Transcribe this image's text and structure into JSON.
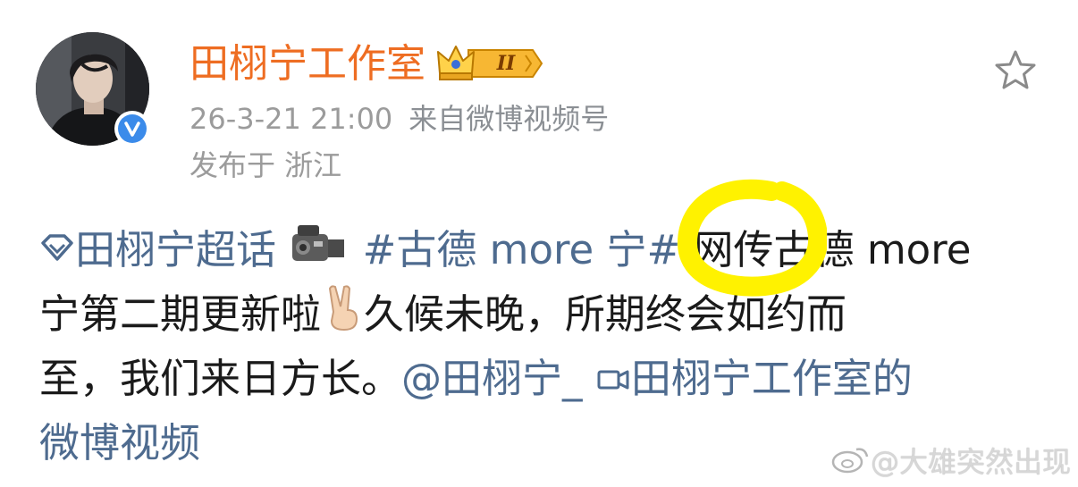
{
  "account": {
    "username": "田栩宁工作室",
    "badge_level": "II",
    "timestamp": "26-3-21 21:00",
    "source": "来自微博视频号",
    "location": "发布于 浙江"
  },
  "post": {
    "supertopic": "田栩宁超话",
    "hashtag": "#古德 more 宁#",
    "text_part1": "网传古德 more",
    "text_part2": "宁第二期更新啦",
    "text_part3": "久候未晚，所期终会如约而",
    "text_part4": "至，我们来日方长。",
    "mention": "@田栩宁_",
    "video_link_part1": "田栩宁工作室的",
    "video_link_part2": "微博视频"
  },
  "watermark": {
    "text": "@大雄突然出现"
  },
  "icons": {
    "supertopic": "diamond-icon",
    "camera": "video-camera-emoji",
    "victory": "victory-hand-emoji",
    "video": "video-link-icon",
    "favorite": "star-icon",
    "verified": "verified-v-icon",
    "crown": "crown-icon"
  },
  "colors": {
    "username": "#ee6d22",
    "link": "#4e6b8f",
    "meta": "#9b9b9b",
    "highlight": "#fff200",
    "verified": "#3b8bea"
  }
}
